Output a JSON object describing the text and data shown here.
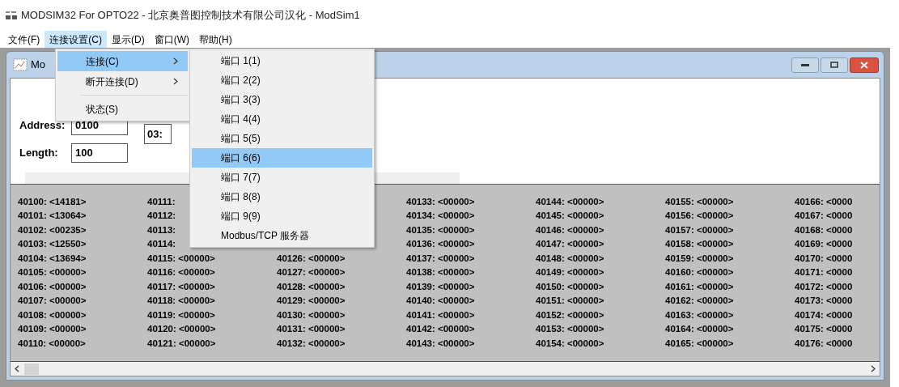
{
  "window": {
    "title": "MODSIM32 For OPTO22 - 北京奥普图控制技术有限公司汉化 - ModSim1"
  },
  "menubar": [
    {
      "label": "文件(F)",
      "selected": false
    },
    {
      "label": "连接设置(C)",
      "selected": true
    },
    {
      "label": "显示(D)",
      "selected": false
    },
    {
      "label": "窗口(W)",
      "selected": false
    },
    {
      "label": "帮助(H)",
      "selected": false
    }
  ],
  "dropdown": [
    {
      "kind": "item",
      "label": "连接(C)",
      "selected": true,
      "submenu": true
    },
    {
      "kind": "item",
      "label": "断开连接(D)",
      "selected": false,
      "submenu": true
    },
    {
      "kind": "separator"
    },
    {
      "kind": "item",
      "label": "状态(S)",
      "selected": false,
      "submenu": false
    }
  ],
  "submenu": [
    {
      "label": "端口 1(1)",
      "selected": false
    },
    {
      "label": "端口 2(2)",
      "selected": false
    },
    {
      "label": "端口 3(3)",
      "selected": false
    },
    {
      "label": "端口 4(4)",
      "selected": false
    },
    {
      "label": "端口 5(5)",
      "selected": false
    },
    {
      "label": "端口 6(6)",
      "selected": true
    },
    {
      "label": "端口 7(7)",
      "selected": false
    },
    {
      "label": "端口 8(8)",
      "selected": false
    },
    {
      "label": "端口 9(9)",
      "selected": false
    },
    {
      "label": "Modbus/TCP 服务器",
      "selected": false
    }
  ],
  "child_window": {
    "title": "Mo",
    "address_label": "Address:",
    "address_value": "0100",
    "length_label": "Length:",
    "length_value": "100",
    "function_value": "03:"
  },
  "register_columns": [
    [
      "40100: <14181>",
      "40101: <13064>",
      "40102: <00235>",
      "40103: <12550>",
      "40104: <13694>",
      "40105: <00000>",
      "40106: <00000>",
      "40107: <00000>",
      "40108: <00000>",
      "40109: <00000>",
      "40110: <00000>"
    ],
    [
      "40111:",
      "40112:",
      "40113:",
      "40114:",
      "40115: <00000>",
      "40116: <00000>",
      "40117: <00000>",
      "40118: <00000>",
      "40119: <00000>",
      "40120: <00000>",
      "40121: <00000>"
    ],
    [
      "40126: <00000>",
      "40127: <00000>",
      "40128: <00000>",
      "40129: <00000>",
      "40130: <00000>",
      "40131: <00000>",
      "40132: <00000>"
    ],
    [
      "40133: <00000>",
      "40134: <00000>",
      "40135: <00000>",
      "40136: <00000>",
      "40137: <00000>",
      "40138: <00000>",
      "40139: <00000>",
      "40140: <00000>",
      "40141: <00000>",
      "40142: <00000>",
      "40143: <00000>"
    ],
    [
      "40144: <00000>",
      "40145: <00000>",
      "40146: <00000>",
      "40147: <00000>",
      "40148: <00000>",
      "40149: <00000>",
      "40150: <00000>",
      "40151: <00000>",
      "40152: <00000>",
      "40153: <00000>",
      "40154: <00000>"
    ],
    [
      "40155: <00000>",
      "40156: <00000>",
      "40157: <00000>",
      "40158: <00000>",
      "40159: <00000>",
      "40160: <00000>",
      "40161: <00000>",
      "40162: <00000>",
      "40163: <00000>",
      "40164: <00000>",
      "40165: <00000>"
    ],
    [
      "40166: <0000",
      "40167: <0000",
      "40168: <0000",
      "40169: <0000",
      "40170: <0000",
      "40171: <0000",
      "40172: <0000",
      "40173: <0000",
      "40174: <0000",
      "40175: <0000",
      "40176: <0000"
    ]
  ]
}
